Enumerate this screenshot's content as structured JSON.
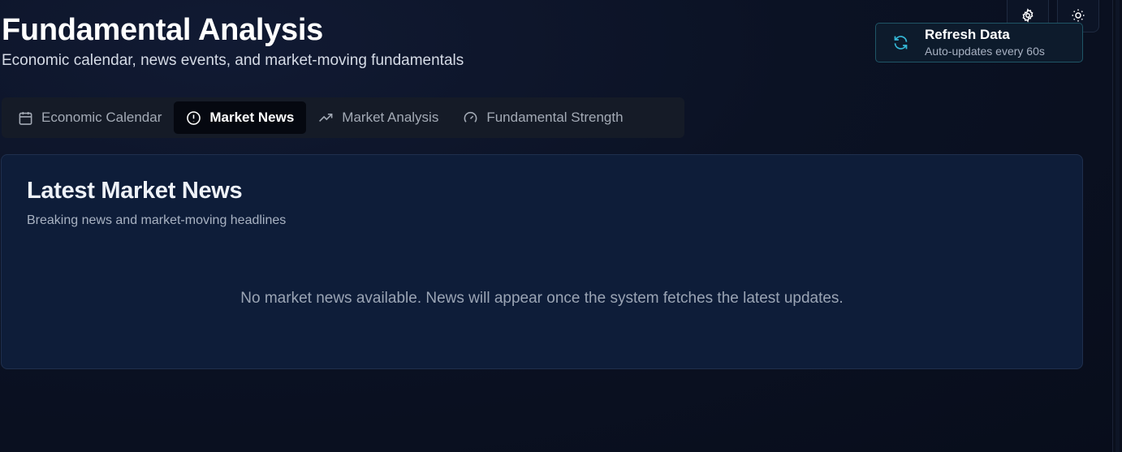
{
  "header": {
    "title": "Fundamental Analysis",
    "subtitle": "Economic calendar, news events, and market-moving fundamentals"
  },
  "toolbar": {
    "settings_icon": "gear-icon",
    "theme_icon": "sun-icon"
  },
  "refresh": {
    "label": "Refresh Data",
    "sublabel": "Auto-updates every 60s",
    "icon": "refresh-icon",
    "accent_color": "#35b9d8"
  },
  "tabs": [
    {
      "label": "Economic Calendar",
      "icon": "calendar-icon",
      "active": false
    },
    {
      "label": "Market News",
      "icon": "alert-circle-icon",
      "active": true
    },
    {
      "label": "Market Analysis",
      "icon": "trending-up-icon",
      "active": false
    },
    {
      "label": "Fundamental Strength",
      "icon": "gauge-icon",
      "active": false
    }
  ],
  "news": {
    "title": "Latest Market News",
    "subtitle": "Breaking news and market-moving headlines",
    "empty_message": "No market news available. News will appear once the system fetches the latest updates."
  }
}
